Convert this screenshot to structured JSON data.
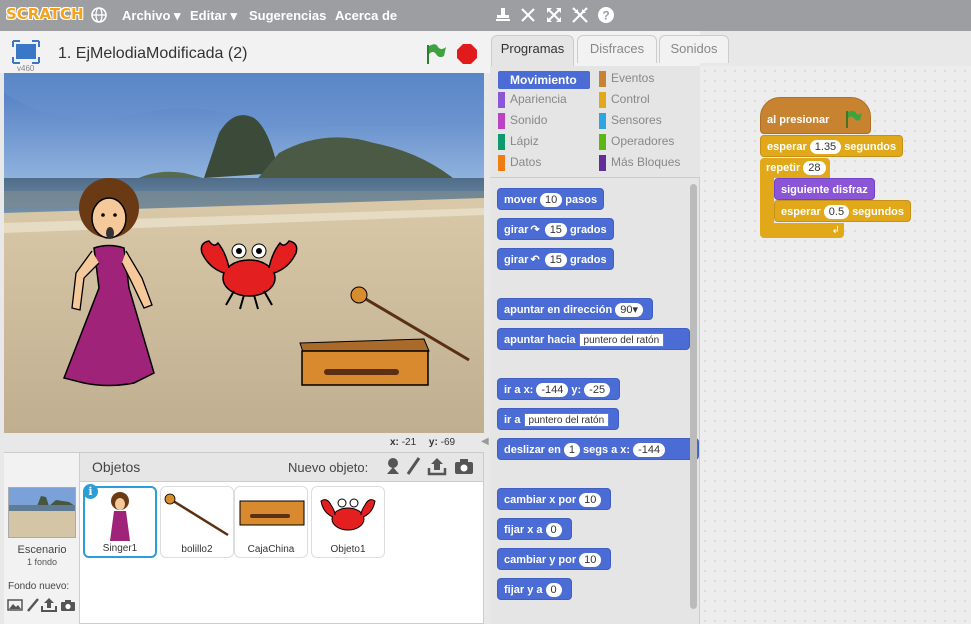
{
  "menubar": {
    "logo": "SCRATCH",
    "items": [
      "Archivo ▾",
      "Editar ▾",
      "Sugerencias",
      "Acerca de"
    ]
  },
  "project": {
    "title": "1. EjMelodiaModificada (2)",
    "version": "v460"
  },
  "stage": {
    "x_label": "x:",
    "x_value": "-21",
    "y_label": "y:",
    "y_value": "-69"
  },
  "sprites": {
    "header": "Objetos",
    "new_label": "Nuevo objeto:",
    "stage_label": "Escenario",
    "stage_count": "1 fondo",
    "new_backdrop": "Fondo nuevo:",
    "items": [
      "Singer1",
      "bolillo2",
      "CajaChina",
      "Objeto1"
    ]
  },
  "tabs": [
    "Programas",
    "Disfraces",
    "Sonidos"
  ],
  "categories": {
    "left": [
      "Movimiento",
      "Apariencia",
      "Sonido",
      "Lápiz",
      "Datos"
    ],
    "right": [
      "Eventos",
      "Control",
      "Sensores",
      "Operadores",
      "Más Bloques"
    ],
    "colors": {
      "Movimiento": "#4a6cd4",
      "Apariencia": "#8a55d7",
      "Sonido": "#bb42c3",
      "Lápiz": "#0e9a6c",
      "Datos": "#ee7d16",
      "Eventos": "#c88330",
      "Control": "#e1a91a",
      "Sensores": "#2ca5e2",
      "Operadores": "#5cb712",
      "Más Bloques": "#632d99"
    }
  },
  "palette": {
    "move": {
      "a": "mover",
      "v": "10",
      "b": "pasos"
    },
    "turn_right": {
      "a": "girar",
      "v": "15",
      "b": "grados"
    },
    "turn_left": {
      "a": "girar",
      "v": "15",
      "b": "grados"
    },
    "point_dir": {
      "a": "apuntar en dirección",
      "v": "90▾"
    },
    "point_to": {
      "a": "apuntar hacia",
      "v": "puntero del ratón"
    },
    "goto_xy": {
      "a": "ir a x:",
      "x": "-144",
      "b": "y:",
      "y": "-25"
    },
    "goto": {
      "a": "ir a",
      "v": "puntero del ratón"
    },
    "glide": {
      "a": "deslizar en",
      "v": "1",
      "b": "segs a x:",
      "x": "-144"
    },
    "change_x": {
      "a": "cambiar x por",
      "v": "10"
    },
    "set_x": {
      "a": "fijar x a",
      "v": "0"
    },
    "change_y": {
      "a": "cambiar y por",
      "v": "10"
    },
    "set_y": {
      "a": "fijar y a",
      "v": "0"
    }
  },
  "script": {
    "hat": "al presionar",
    "wait1": {
      "a": "esperar",
      "v": "1.35",
      "b": "segundos"
    },
    "repeat": {
      "a": "repetir",
      "v": "28"
    },
    "next": "siguiente disfraz",
    "wait2": {
      "a": "esperar",
      "v": "0.5",
      "b": "segundos"
    }
  }
}
